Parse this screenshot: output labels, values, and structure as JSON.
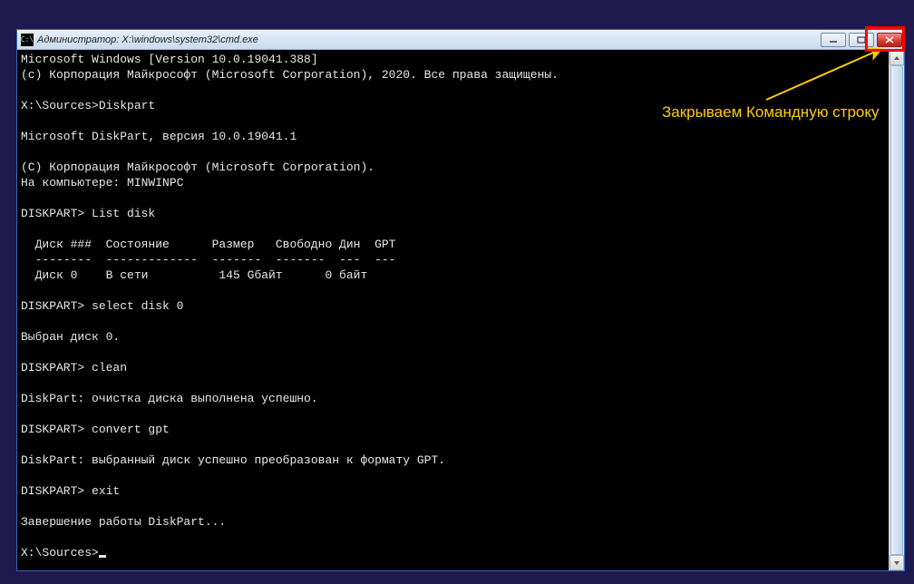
{
  "window": {
    "title": "Администратор: X:\\windows\\system32\\cmd.exe",
    "app_icon_text": "C:\\"
  },
  "annotation": {
    "text": "Закрываем Командную строку"
  },
  "console": {
    "lines": [
      "Microsoft Windows [Version 10.0.19041.388]",
      "(c) Корпорация Майкрософт (Microsoft Corporation), 2020. Все права защищены.",
      "",
      "X:\\Sources>Diskpart",
      "",
      "Microsoft DiskPart, версия 10.0.19041.1",
      "",
      "(C) Корпорация Майкрософт (Microsoft Corporation).",
      "На компьютере: MINWINPC",
      "",
      "DISKPART> List disk",
      "",
      "  Диск ###  Состояние      Размер   Свободно Дин  GPT",
      "  --------  -------------  -------  -------  ---  ---",
      "  Диск 0    В сети          145 Gбайт      0 байт",
      "",
      "DISKPART> select disk 0",
      "",
      "Выбран диск 0.",
      "",
      "DISKPART> clean",
      "",
      "DiskPart: очистка диска выполнена успешно.",
      "",
      "DISKPART> convert gpt",
      "",
      "DiskPart: выбранный диск успешно преобразован к формату GPT.",
      "",
      "DISKPART> exit",
      "",
      "Завершение работы DiskPart...",
      "",
      "X:\\Sources>"
    ]
  }
}
